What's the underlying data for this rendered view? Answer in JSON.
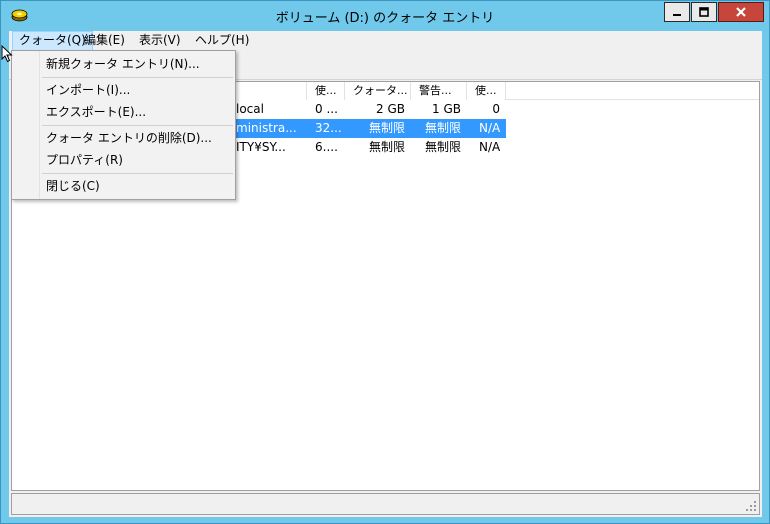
{
  "window": {
    "title": "ボリューム (D:) のクォータ エントリ",
    "icon": "disk-quota-icon"
  },
  "menubar": [
    {
      "label": "クォータ(Q)",
      "active": true
    },
    {
      "label": "編集(E)"
    },
    {
      "label": "表示(V)"
    },
    {
      "label": "ヘルプ(H)"
    }
  ],
  "dropdown": {
    "items": [
      "新規クォータ エントリ(N)...",
      "インポート(I)...",
      "エクスポート(E)...",
      "クォータ エントリの削除(D)...",
      "プロパティ(R)",
      "閉じる(C)"
    ]
  },
  "list": {
    "headers": [
      "使...",
      "クォータ...",
      "警告...",
      "使..."
    ],
    "rows": [
      {
        "name": "local",
        "used": "0 ...",
        "quota": "2 GB",
        "warning": "1 GB",
        "pct": "0",
        "selected": false
      },
      {
        "name": "ministra...",
        "used": "32...",
        "quota": "無制限",
        "warning": "無制限",
        "pct": "N/A",
        "selected": true
      },
      {
        "name": "ITY¥SY...",
        "used": "6....",
        "quota": "無制限",
        "warning": "無制限",
        "pct": "N/A",
        "selected": false
      }
    ]
  },
  "colors": {
    "frame": "#70c9ea",
    "selection": "#3399ff",
    "close_button": "#c7463c"
  }
}
